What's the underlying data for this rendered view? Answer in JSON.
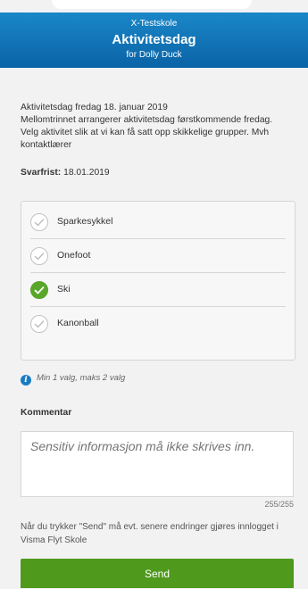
{
  "header": {
    "school": "X-Testskole",
    "title": "Aktivitetsdag",
    "subtitle": "for Dolly Duck"
  },
  "message": {
    "description": "Aktivitetsdag fredag 18. januar 2019\nMellomtrinnet arrangerer aktivitetsdag førstkommende fredag. Velg aktivitet slik at vi kan få satt opp skikkelige grupper. Mvh kontaktlærer",
    "deadline_label": "Svarfrist:",
    "deadline_value": "18.01.2019"
  },
  "options": [
    {
      "label": "Sparkesykkel",
      "selected": false
    },
    {
      "label": "Onefoot",
      "selected": false
    },
    {
      "label": "Ski",
      "selected": true
    },
    {
      "label": "Kanonball",
      "selected": false
    }
  ],
  "hint": {
    "icon": "info-icon",
    "text": "Min 1 valg, maks 2 valg"
  },
  "comment": {
    "label": "Kommentar",
    "placeholder": "Sensitiv informasjon må ikke skrives inn.",
    "value": "",
    "counter": "255/255"
  },
  "note": "Når du trykker \"Send\" må evt. senere endringer gjøres innlogget i Visma Flyt Skole",
  "send_label": "Send",
  "colors": {
    "header": "#0a63a6",
    "accent_green": "#4f9a1d",
    "check_selected": "#59a72a",
    "info_blue": "#1a7cc3"
  }
}
